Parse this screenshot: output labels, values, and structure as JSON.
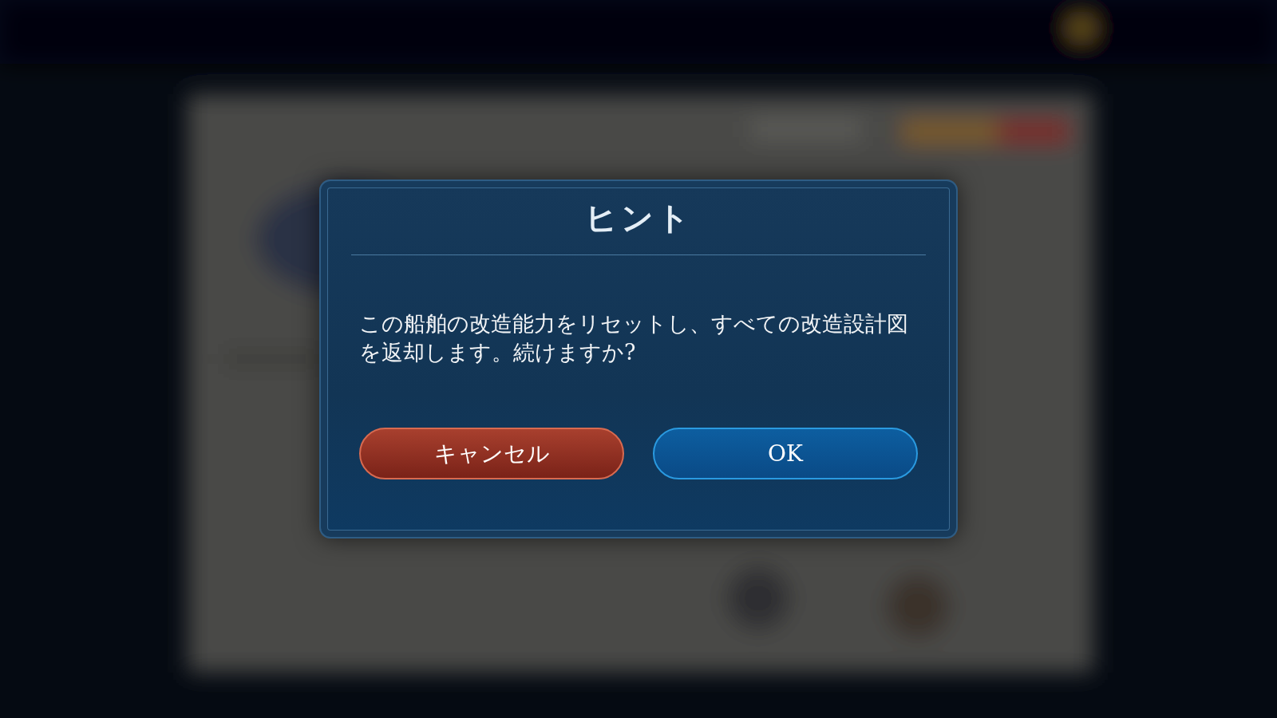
{
  "dialog": {
    "title": "ヒント",
    "message": "この船舶の改造能力をリセットし、すべての改造設計図を返却します。続けますか?",
    "buttons": [
      {
        "label": "キャンセル",
        "kind": "cancel"
      },
      {
        "label": "OK",
        "kind": "confirm"
      }
    ]
  }
}
